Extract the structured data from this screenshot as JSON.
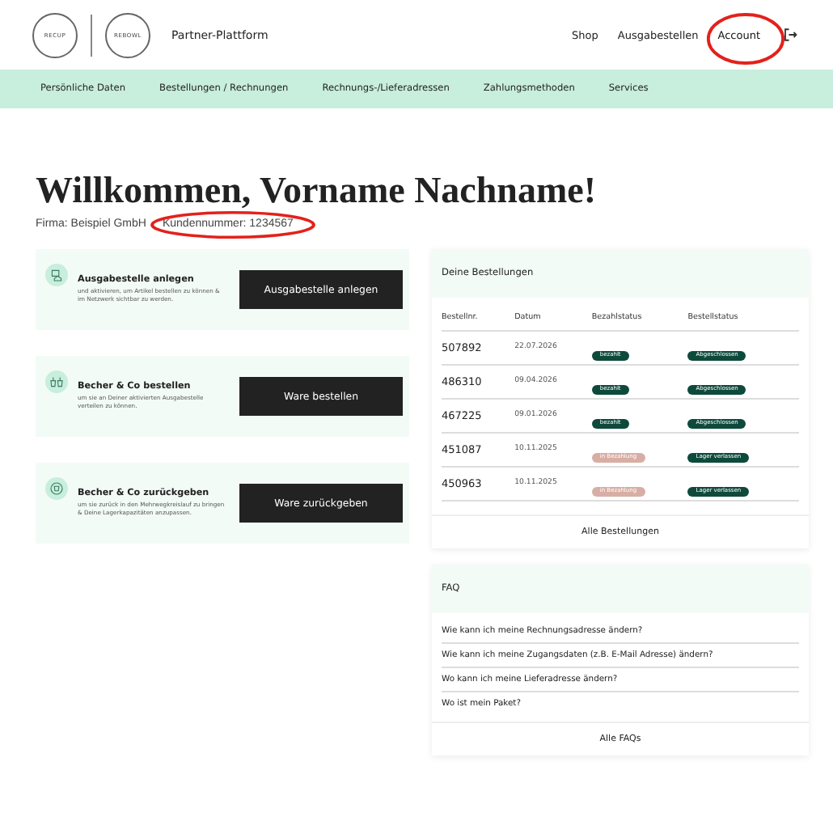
{
  "header": {
    "logos": [
      "RECUP",
      "REBOWL"
    ],
    "title": "Partner-Plattform",
    "nav": [
      {
        "label": "Shop",
        "highlighted": false
      },
      {
        "label": "Ausgabestellen",
        "highlighted": false
      },
      {
        "label": "Account",
        "highlighted": true
      }
    ]
  },
  "subnav": [
    "Persönliche Daten",
    "Bestellungen / Rechnungen",
    "Rechnungs-/Lieferadressen",
    "Zahlungsmethoden",
    "Services"
  ],
  "welcome": {
    "heading": "Willkommen, Vorname Nachname!",
    "company": "Firma: Beispiel GmbH",
    "customer_number": "Kundennummer: 1234567",
    "customer_number_highlighted": true
  },
  "actions": [
    {
      "kind": "location",
      "title": "Ausgabestelle anlegen",
      "text": "und aktivieren, um Artikel bestellen zu können & im Netzwerk sichtbar zu werden.",
      "button": "Ausgabestelle anlegen"
    },
    {
      "kind": "cups",
      "title": "Becher & Co bestellen",
      "text": "um sie an Deiner aktivierten Ausgabestelle verteilen zu können.",
      "button": "Ware bestellen"
    },
    {
      "kind": "return",
      "title": "Becher & Co zurückgeben",
      "text": "um sie zurück in den Mehrwegkreislauf zu bringen & Deine Lagerkapazitäten anzupassen.",
      "button": "Ware zurückgeben"
    }
  ],
  "orders": {
    "title": "Deine Bestellungen",
    "columns": [
      "Bestellnr.",
      "Datum",
      "Bezahlstatus",
      "Bestellstatus"
    ],
    "rows": [
      {
        "number": "507892",
        "date": "22.07.2026",
        "payment": {
          "label": "bezahlt",
          "kind": "done"
        },
        "status": {
          "label": "Abgeschlossen",
          "kind": "done"
        }
      },
      {
        "number": "486310",
        "date": "09.04.2026",
        "payment": {
          "label": "bezahlt",
          "kind": "done"
        },
        "status": {
          "label": "Abgeschlossen",
          "kind": "done"
        }
      },
      {
        "number": "467225",
        "date": "09.01.2026",
        "payment": {
          "label": "bezahlt",
          "kind": "done"
        },
        "status": {
          "label": "Abgeschlossen",
          "kind": "done"
        }
      },
      {
        "number": "451087",
        "date": "10.11.2025",
        "payment": {
          "label": "in Bezahlung",
          "kind": "pending"
        },
        "status": {
          "label": "Lager verlassen",
          "kind": "done"
        }
      },
      {
        "number": "450963",
        "date": "10.11.2025",
        "payment": {
          "label": "in Bezahlung",
          "kind": "pending"
        },
        "status": {
          "label": "Lager verlassen",
          "kind": "done"
        }
      }
    ],
    "link": "Alle Bestellungen"
  },
  "faq": {
    "title": "FAQ",
    "items": [
      "Wie kann ich meine Rechnungsadresse ändern?",
      "Wie kann ich meine Zugangsdaten (z.B. E-Mail Adresse) ändern?",
      "Wo kann ich meine Lieferadresse ändern?",
      "Wo ist mein Paket?"
    ],
    "link": "Alle FAQs"
  }
}
